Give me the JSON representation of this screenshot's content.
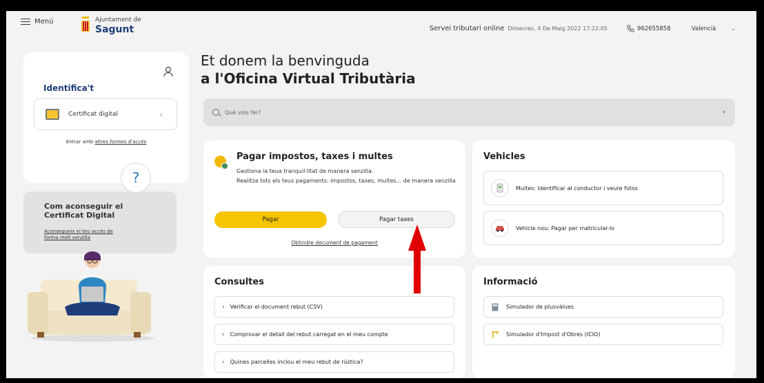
{
  "header": {
    "menu_label": "Menú",
    "logo_top": "Ajuntament de",
    "logo_main": "Sagunt",
    "service": "Servei tributari online",
    "date": "Dimecres, 4 De Maig 2022 17:22:05",
    "phone": "962655858",
    "language": "Valencià"
  },
  "sidebar": {
    "identify_title": "Identifica't",
    "certificate_button": "Certificat digital",
    "alt_prefix": "Entrar amb ",
    "alt_link": "altres formes d'accés",
    "help_title": "Com aconseguir el Certificat Digital",
    "help_link": "Aconsegueix el teu accés de forma molt senzilla",
    "help_symbol": "?"
  },
  "main": {
    "welcome_line1": "Et donem la benvinguda",
    "welcome_line2": "a l'Oficina Virtual Tributària",
    "search_placeholder": "Què vols fer?"
  },
  "pay": {
    "title": "Pagar impostos, taxes i multes",
    "subtitle1": "Gestiona la teua tranquil·litat de manera senzilla.",
    "subtitle2": "Realitza tots els teus pagaments: impostos, taxes, multes... de manera senzilla",
    "btn_pay": "Pagar",
    "btn_taxes": "Pagar taxes",
    "doc_link": "Obtindre document de pagament"
  },
  "vehicles": {
    "title": "Vehicles",
    "items": [
      "Multes: Identificar al conductor i veure fotos",
      "Vehicle nou: Pagar per matricular-lo"
    ]
  },
  "consultes": {
    "title": "Consultes",
    "items": [
      "Verificar el document rebut (CSV)",
      "Comprovar el detall del rebut carregat en el meu compte",
      "Quines parcelles inclou el meu rebut de rústica?"
    ]
  },
  "informacio": {
    "title": "Informació",
    "items": [
      "Simulador de plusvàlues",
      "Simulador d'Impost d'Obres (ICIO)"
    ]
  },
  "colors": {
    "brand": "#1f3d7a",
    "accent_yellow": "#f6c400",
    "arrow_red": "#e00000"
  }
}
